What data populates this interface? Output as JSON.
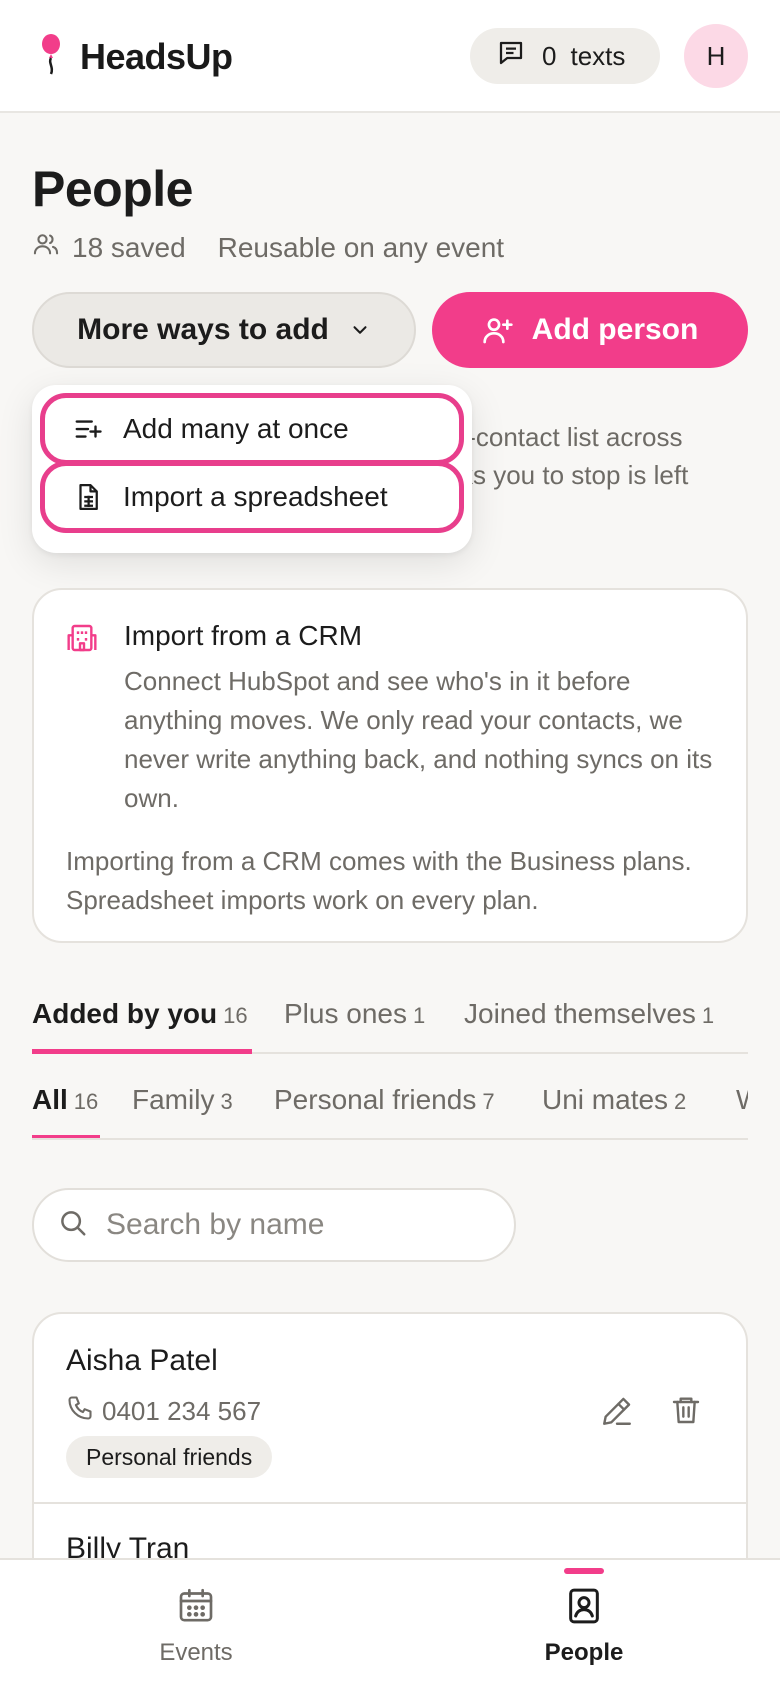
{
  "header": {
    "brand": "HeadsUp",
    "texts_count": "0",
    "texts_label": "texts",
    "avatar_initial": "H"
  },
  "page": {
    "title": "People",
    "saved_label": "18 saved",
    "reusable_label": "Reusable on any event"
  },
  "actions": {
    "more_ways_label": "More ways to add",
    "add_person_label": "Add person"
  },
  "dropdown": {
    "items": [
      {
        "label": "Add many at once",
        "icon": "list-add-icon"
      },
      {
        "label": "Import a spreadsheet",
        "icon": "spreadsheet-icon"
      }
    ]
  },
  "obscured_text": {
    "line1": "t-contact list across",
    "line2": "ks you to stop is left"
  },
  "crm_card": {
    "title": "Import from a CRM",
    "description": "Connect HubSpot and see who's in it before anything moves. We only read your contacts, we never write anything back, and nothing syncs on its own.",
    "footnote": "Importing from a CRM comes with the Business plans. Spreadsheet imports work on every plan."
  },
  "source_tabs": [
    {
      "label": "Added by you",
      "count": "16",
      "active": true
    },
    {
      "label": "Plus ones",
      "count": "1",
      "active": false
    },
    {
      "label": "Joined themselves",
      "count": "1",
      "active": false
    }
  ],
  "group_tabs": [
    {
      "label": "All",
      "count": "16",
      "active": true
    },
    {
      "label": "Family",
      "count": "3",
      "active": false
    },
    {
      "label": "Personal friends",
      "count": "7",
      "active": false
    },
    {
      "label": "Uni mates",
      "count": "2",
      "active": false
    },
    {
      "label": "W",
      "count": "",
      "active": false
    }
  ],
  "search": {
    "placeholder": "Search by name",
    "value": ""
  },
  "people": [
    {
      "name": "Aisha Patel",
      "phone": "0401 234 567",
      "tag": "Personal friends"
    },
    {
      "name": "Billy Tran"
    }
  ],
  "bottom_nav": [
    {
      "label": "Events",
      "icon": "calendar-icon",
      "active": false
    },
    {
      "label": "People",
      "icon": "contacts-book-icon",
      "active": true
    }
  ],
  "colors": {
    "accent": "#f23d8a",
    "background": "#f8f7f5",
    "muted_text": "#6e6b66"
  }
}
